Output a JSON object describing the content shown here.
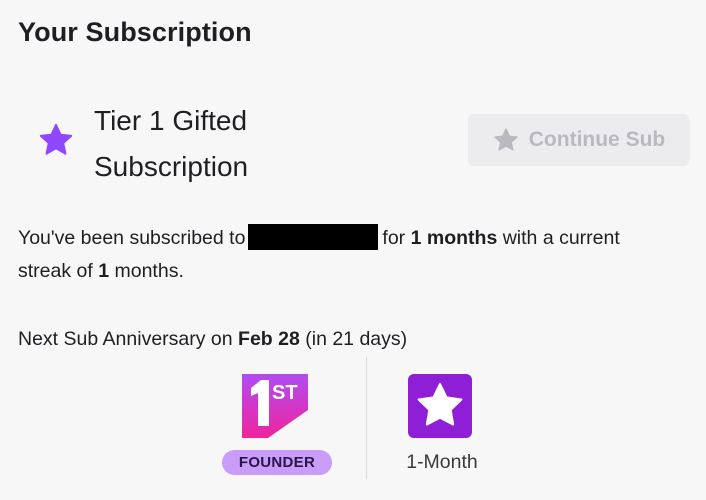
{
  "title": "Your Subscription",
  "subscription": {
    "tier_line1": "Tier 1 Gifted",
    "tier_line2": "Subscription",
    "continue_label": "Continue Sub",
    "accent_color": "#9147ff"
  },
  "streak": {
    "prefix": "You've been subscribed to",
    "after_channel": "for",
    "months_total": "1 months",
    "with_streak": "with a current streak of",
    "streak_count": "1",
    "streak_unit": "months."
  },
  "anniversary": {
    "prefix": "Next Sub Anniversary on",
    "date": "Feb 28",
    "suffix": "(in 21 days)"
  },
  "badges": [
    {
      "icon": "first-founder-badge-icon",
      "label": "FOUNDER"
    },
    {
      "icon": "one-month-star-badge-icon",
      "label": "1-Month"
    }
  ]
}
